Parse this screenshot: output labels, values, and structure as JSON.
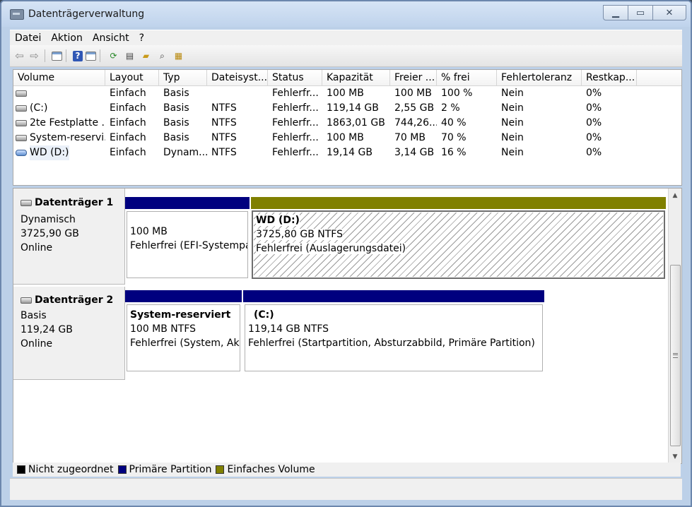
{
  "window": {
    "title": "Datenträgerverwaltung"
  },
  "menu": [
    "Datei",
    "Aktion",
    "Ansicht",
    "?"
  ],
  "toolbar_icons": [
    "back-arrow-icon",
    "forward-arrow-icon",
    "view-icon",
    "help-icon",
    "properties-view-icon",
    "refresh-icon",
    "properties-icon",
    "open-folder-icon",
    "search-icon",
    "rescan-icon"
  ],
  "volume_list": {
    "columns": [
      "Volume",
      "Layout",
      "Typ",
      "Dateisyst...",
      "Status",
      "Kapazität",
      "Freier ...",
      "% frei",
      "Fehlertoleranz",
      "Restkap..."
    ],
    "rows": [
      {
        "icon": "disk-icon",
        "name": "",
        "layout": "Einfach",
        "typ": "Basis",
        "fs": "",
        "status": "Fehlerfr...",
        "kap": "100 MB",
        "frei": "100 MB",
        "pct": "100 %",
        "ft": "Nein",
        "rest": "0%"
      },
      {
        "icon": "disk-icon",
        "name": "(C:)",
        "layout": "Einfach",
        "typ": "Basis",
        "fs": "NTFS",
        "status": "Fehlerfr...",
        "kap": "119,14 GB",
        "frei": "2,55 GB",
        "pct": "2 %",
        "ft": "Nein",
        "rest": "0%"
      },
      {
        "icon": "disk-icon",
        "name": "2te Festplatte ...",
        "layout": "Einfach",
        "typ": "Basis",
        "fs": "NTFS",
        "status": "Fehlerfr...",
        "kap": "1863,01 GB",
        "frei": "744,26...",
        "pct": "40 %",
        "ft": "Nein",
        "rest": "0%"
      },
      {
        "icon": "disk-icon",
        "name": "System-reservi...",
        "layout": "Einfach",
        "typ": "Basis",
        "fs": "NTFS",
        "status": "Fehlerfr...",
        "kap": "100 MB",
        "frei": "70 MB",
        "pct": "70 %",
        "ft": "Nein",
        "rest": "0%"
      },
      {
        "icon": "disk-blue-icon",
        "name": "WD (D:)",
        "layout": "Einfach",
        "typ": "Dynam...",
        "fs": "NTFS",
        "status": "Fehlerfr...",
        "kap": "19,14 GB",
        "frei": "3,14 GB",
        "pct": "16 %",
        "ft": "Nein",
        "rest": "0%"
      }
    ]
  },
  "disks": [
    {
      "name": "Datenträger 1",
      "type": "Dynamisch",
      "size": "3725,90 GB",
      "state": "Online",
      "partitions": [
        {
          "title": "",
          "line1": "100 MB",
          "line2": "Fehlerfrei (EFI-Systempartition)",
          "bar_color": "#00007f",
          "hatched": false
        },
        {
          "title": "WD  (D:)",
          "line1": "3725,80 GB NTFS",
          "line2": "Fehlerfrei (Auslagerungsdatei)",
          "bar_color": "#808000",
          "hatched": true
        }
      ]
    },
    {
      "name": "Datenträger 2",
      "type": "Basis",
      "size": "119,24 GB",
      "state": "Online",
      "partitions": [
        {
          "title": "System-reserviert",
          "line1": "100 MB NTFS",
          "line2": "Fehlerfrei (System, Aktiv, Primäre Partition)",
          "bar_color": "#00007f",
          "hatched": false
        },
        {
          "title": "(C:)",
          "line1": "119,14 GB NTFS",
          "line2": "Fehlerfrei (Startpartition, Absturzabbild, Primäre Partition)",
          "bar_color": "#00007f",
          "hatched": false
        }
      ]
    }
  ],
  "legend": [
    {
      "label": "Nicht zugeordnet",
      "color": "#000000"
    },
    {
      "label": "Primäre Partition",
      "color": "#00007f"
    },
    {
      "label": "Einfaches Volume",
      "color": "#808000"
    }
  ]
}
